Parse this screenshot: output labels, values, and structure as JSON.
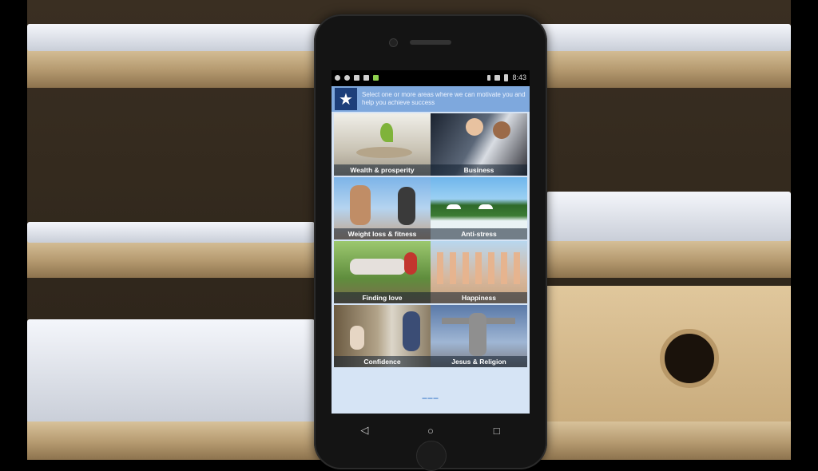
{
  "status_bar": {
    "time": "8:43"
  },
  "app": {
    "header_text": "Select one or more areas where we can motivate you and help you achieve success",
    "logo_icon": "star-icon",
    "categories": [
      {
        "label": "Wealth & prosperity"
      },
      {
        "label": "Business"
      },
      {
        "label": "Weight loss & fitness"
      },
      {
        "label": "Anti-stress"
      },
      {
        "label": "Finding love"
      },
      {
        "label": "Happiness"
      },
      {
        "label": "Confidence"
      },
      {
        "label": "Jesus & Religion"
      }
    ]
  },
  "nav_bar": {
    "back_icon": "back-triangle-icon",
    "home_icon": "home-circle-icon",
    "recents_icon": "recents-square-icon"
  },
  "colors": {
    "header": "#7ea8dd",
    "app_background": "#d6e4f5"
  }
}
